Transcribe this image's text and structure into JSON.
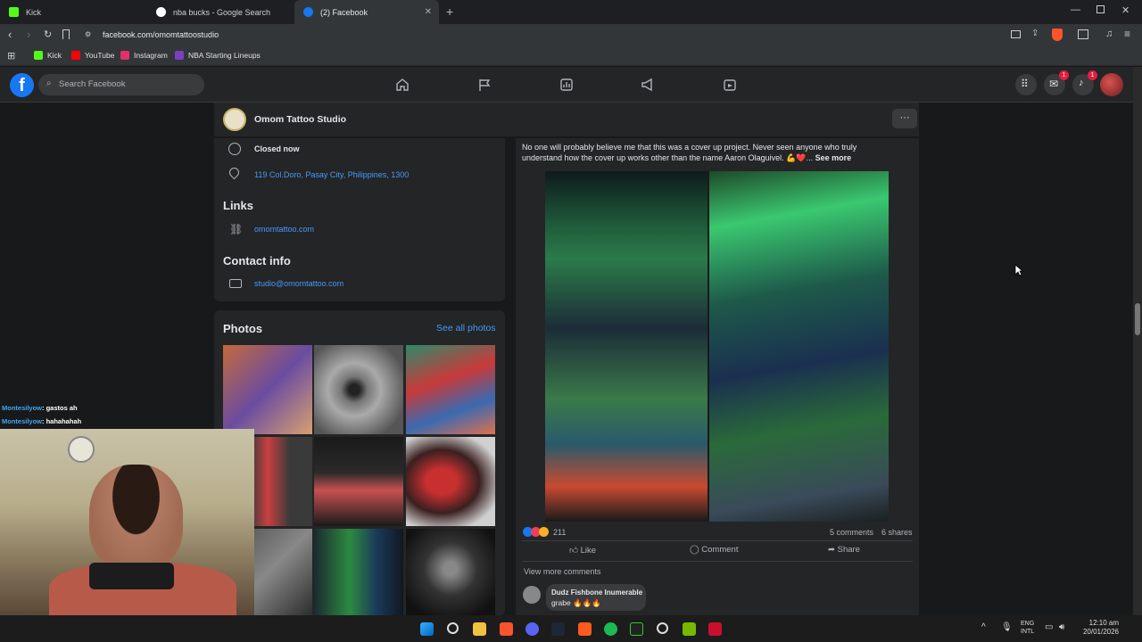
{
  "browser": {
    "tabs": [
      {
        "label": "Kick",
        "color": "#53fc18"
      },
      {
        "label": "nba bucks - Google Search",
        "color": "#ffffff"
      },
      {
        "label": "(2) Facebook",
        "color": "#1877f2"
      }
    ],
    "url": "facebook.com/omomtattoostudio",
    "bookmarks": [
      {
        "label": "Kick",
        "color": "#53fc18"
      },
      {
        "label": "YouTube",
        "color": "#ff0000"
      },
      {
        "label": "Instagram",
        "color": "#e1306c"
      },
      {
        "label": "NBA Starting Lineups",
        "color": "#7b3fbf"
      }
    ]
  },
  "fb": {
    "search_placeholder": "Search Facebook",
    "messenger_badge": "1",
    "notif_badge": "1",
    "accent": "#1877f2"
  },
  "page": {
    "name": "Omom Tattoo Studio",
    "hours": "Closed now",
    "address": "119 Col.Doro, Pasay City, Philippines, 1300",
    "links_heading": "Links",
    "website": "omomtattoo.com",
    "contact_heading": "Contact info",
    "email": "studio@omomtattoo.com",
    "photos_heading": "Photos",
    "see_all_photos": "See all photos"
  },
  "post": {
    "text": "No one will probably believe me that this was a cover up project. Never seen anyone who truly understand how the cover up works other than the name Aaron Olaguivel. 💪❤️...",
    "see_more": "See more",
    "reaction_count": "211",
    "comments_count": "5 comments",
    "shares_count": "6 shares",
    "like_label": "Like",
    "comment_label": "Comment",
    "share_label": "Share",
    "view_more_comments": "View more comments",
    "commenter": "Dudz Fishbone Inumerable",
    "comment_text": "grabe 🔥🔥🔥"
  },
  "chat": [
    {
      "user": "Montesilyow",
      "msg": ": gastos ah"
    },
    {
      "user": "Montesilyow",
      "msg": ": hahahahah"
    }
  ],
  "tray": {
    "lang_top": "ENG",
    "lang_bottom": "INTL",
    "time": "12:10 am",
    "date": "20/01/2026"
  }
}
